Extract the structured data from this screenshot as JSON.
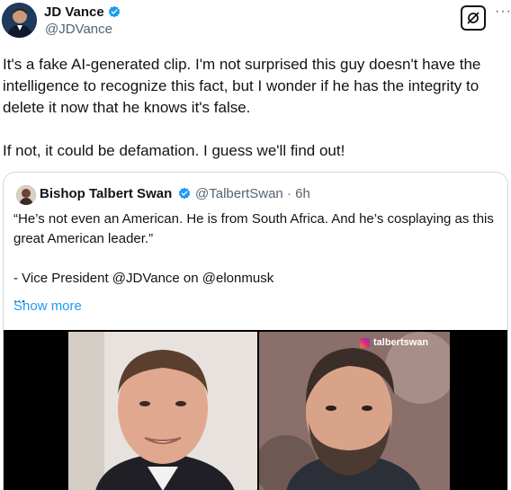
{
  "author": {
    "name": "JD Vance",
    "handle": "@JDVance",
    "avatar_icon": "avatar-photo",
    "verified_color": "#1d9bf0"
  },
  "actions": {
    "grok_icon": "grok-icon",
    "more_label": "···"
  },
  "tweet": {
    "paragraph1": "It's a fake AI-generated clip. I'm not surprised this guy doesn't have the intelligence to recognize this fact, but I wonder if he has the integrity to delete it now that he knows it's false.",
    "paragraph2": "If not, it could be defamation. I guess we'll find out!"
  },
  "quoted": {
    "name": "Bishop Talbert Swan",
    "handle_time": "@TalbertSwan · 6h",
    "line1": "“He’s not even an American. He is from South Africa. And he’s cosplaying as this great American leader.”",
    "line2": "- Vice President @JDVance on @elonmusk",
    "ellipsis": "...",
    "show_more": "Show more",
    "watermark": "talbertswan",
    "link_color": "#1d9bf0"
  }
}
